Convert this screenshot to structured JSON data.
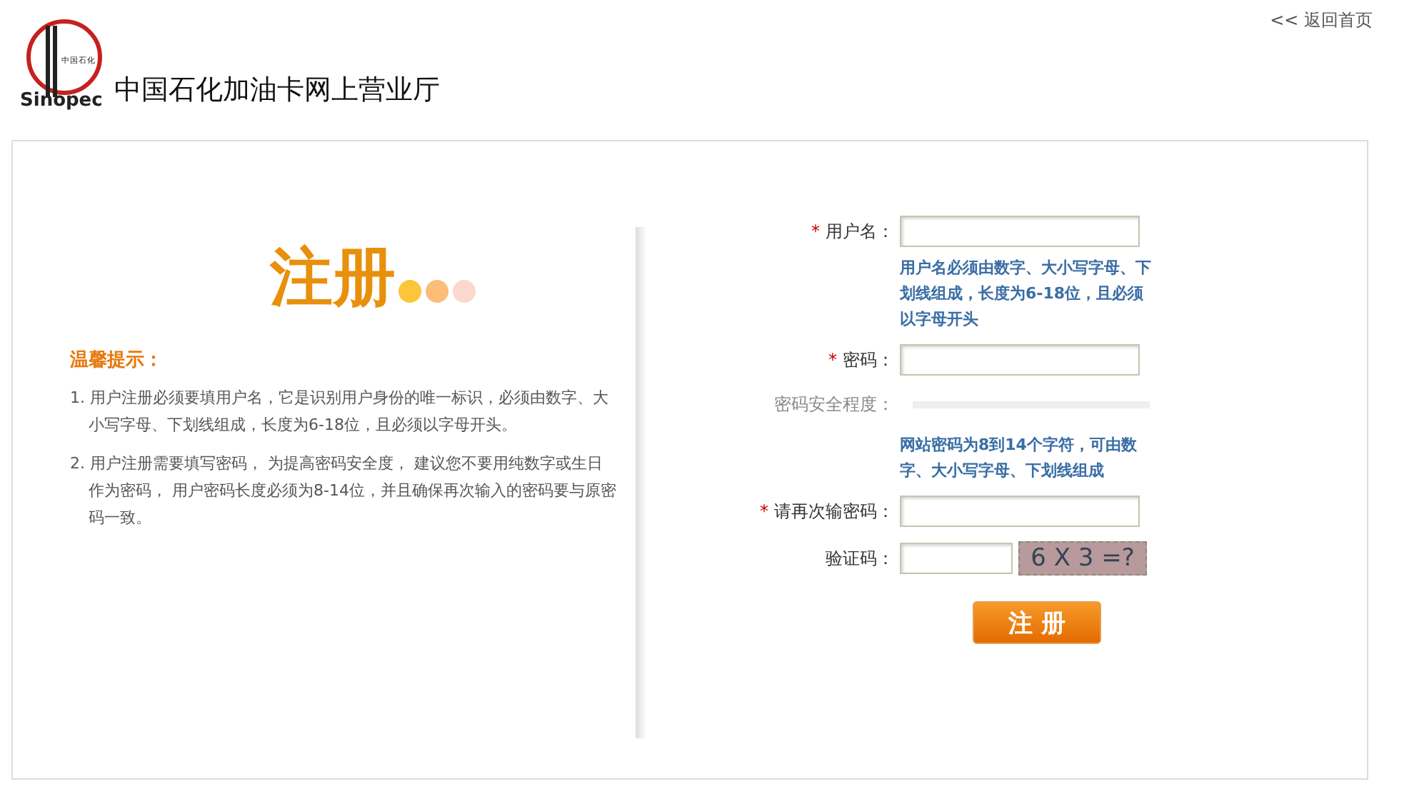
{
  "header": {
    "logo": {
      "mark_text": "中国石化",
      "wordmark": "Sinopec"
    },
    "title": "中国石化加油卡网上营业厅",
    "back_link": "<< 返回首页"
  },
  "intro": {
    "heading": "注册",
    "tips_title": "温馨提示：",
    "tips": [
      "1. 用户注册必须要填用户名，它是识别用户身份的唯一标识，必须由数字、大小写字母、下划线组成，长度为6-18位，且必须以字母开头。",
      "2. 用户注册需要填写密码， 为提高密码安全度， 建议您不要用纯数字或生日作为密码， 用户密码长度必须为8-14位，并且确保再次输入的密码要与原密码一致。"
    ]
  },
  "form": {
    "rows": [
      {
        "kind": "field",
        "required_mark": "*",
        "label": "用户名："
      },
      {
        "kind": "hint",
        "text": "用户名必须由数字、大小写字母、下划线组成，长度为6-18位，且必须以字母开头"
      },
      {
        "kind": "field",
        "required_mark": "*",
        "label": "密码："
      },
      {
        "kind": "strength",
        "label": "密码安全程度："
      },
      {
        "kind": "hint",
        "text": "网站密码为8到14个字符，可由数字、大小写字母、下划线组成"
      },
      {
        "kind": "field",
        "required_mark": "*",
        "label": "请再次输密码："
      },
      {
        "kind": "captcha",
        "label": "验证码：",
        "captcha_text": "6 X 3 =?"
      }
    ],
    "submit": "注 册"
  }
}
